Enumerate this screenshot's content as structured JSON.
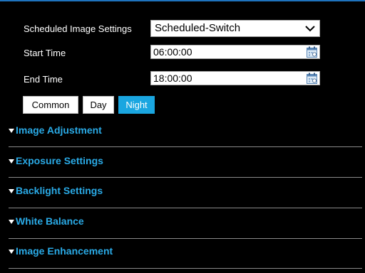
{
  "scheduled": {
    "label": "Scheduled Image Settings",
    "value": "Scheduled-Switch"
  },
  "start_time": {
    "label": "Start Time",
    "value": "06:00:00"
  },
  "end_time": {
    "label": "End Time",
    "value": "18:00:00"
  },
  "mode_tabs": [
    {
      "label": "Common",
      "active": false
    },
    {
      "label": "Day",
      "active": false
    },
    {
      "label": "Night",
      "active": true
    }
  ],
  "sections": [
    {
      "title": "Image Adjustment"
    },
    {
      "title": "Exposure Settings"
    },
    {
      "title": "Backlight Settings"
    },
    {
      "title": "White Balance"
    },
    {
      "title": "Image Enhancement"
    }
  ],
  "colors": {
    "accent": "#1aa6e0",
    "section_title": "#2aaae6",
    "background": "#000000"
  },
  "icons": {
    "dropdown": "chevron-down-icon",
    "calendar": "calendar-icon",
    "section_toggle": "caret-down-icon"
  }
}
